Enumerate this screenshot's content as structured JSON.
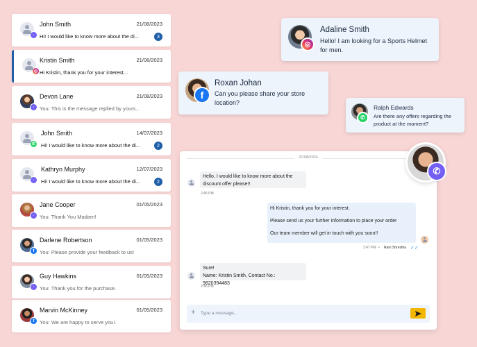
{
  "conversations": [
    {
      "name": "John Smith",
      "date": "21/08/2023",
      "preview": "Hi! I would like to know more about the di...",
      "unread": "3",
      "channel": "viber",
      "avatar": "generic",
      "muted": false
    },
    {
      "name": "Kristin Smith",
      "date": "21/08/2023",
      "preview": "Hi Kristin, thank you for your interest...",
      "unread": "",
      "channel": "instagram",
      "avatar": "generic",
      "muted": false,
      "active": true
    },
    {
      "name": "Devon Lane",
      "date": "21/08/2023",
      "preview": "You: This is the message replied by yours...",
      "unread": "",
      "channel": "viber",
      "avatar": "photo",
      "muted": true
    },
    {
      "name": "John Smith",
      "date": "14/07/2023",
      "preview": "Hi! I would like to know more about the di...",
      "unread": "2",
      "channel": "whatsapp",
      "avatar": "generic",
      "muted": false
    },
    {
      "name": "Kathryn Murphy",
      "date": "12/07/2023",
      "preview": "Hi! I would like to know more about the di...",
      "unread": "2",
      "channel": "viber",
      "avatar": "generic",
      "muted": false
    },
    {
      "name": "Jane Cooper",
      "date": "01/05/2023",
      "preview": "You: Thank You Madam!",
      "unread": "",
      "channel": "viber",
      "avatar": "photo2",
      "muted": true
    },
    {
      "name": "Darlene Robertson",
      "date": "01/05/2023",
      "preview": "You: Please provide your feedback to us!",
      "unread": "",
      "channel": "facebook",
      "avatar": "photo3",
      "muted": true
    },
    {
      "name": "Guy Hawkins",
      "date": "01/05/2023",
      "preview": "You: Thank you for the purchase.",
      "unread": "",
      "channel": "viber",
      "avatar": "photo4",
      "muted": true
    },
    {
      "name": "Marvin McKinney",
      "date": "01/05/2023",
      "preview": "You: We are happy to serve you!.",
      "unread": "",
      "channel": "facebook",
      "avatar": "photo5",
      "muted": true
    }
  ],
  "bubbles": {
    "adaline": {
      "name": "Adaline Smith",
      "text": "Hello! I am looking for a Sports Helmet for men."
    },
    "roxan": {
      "name": "Roxan Johan",
      "text": "Can you please share your store location?"
    },
    "ralph": {
      "name": "Ralph Edwards",
      "text": "Are there any offers regarding the product at the moment?"
    }
  },
  "chat": {
    "date": "21/08/2024",
    "messages": [
      {
        "dir": "in",
        "text": "Hello, I would like to know more about the discount offer please!!",
        "time": "2:45 PM"
      },
      {
        "dir": "out",
        "lines": [
          "Hi Kristin, thank you for your interest.",
          "Please send us your further information to place your order",
          "Our team member will get in touch with you soon!!"
        ],
        "time": "2:47 PM",
        "agent": "Ram Shrestha"
      },
      {
        "dir": "in",
        "lines": [
          "Sure!",
          "Name: Kristin Smith, Contact No.: 9820394483"
        ],
        "time": "2:45 PM"
      }
    ],
    "input_placeholder": "Type a message...",
    "plus": "+"
  },
  "colors": {
    "background": "#f8d6d6",
    "accent": "#1f5fa8",
    "send": "#f2b705",
    "viber": "#7360f2",
    "facebook": "#1877f2",
    "whatsapp": "#25d366"
  }
}
